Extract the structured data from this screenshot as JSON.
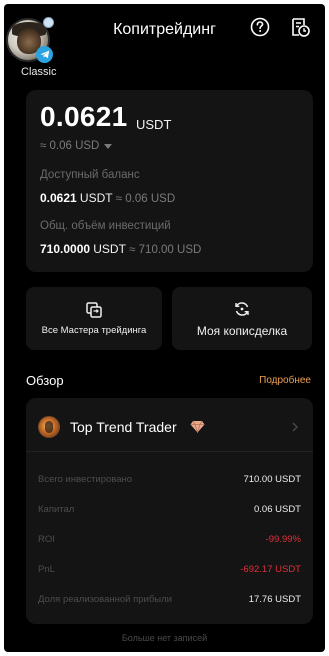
{
  "header": {
    "title": "Копитрейдинг",
    "account_label": "Classic",
    "icons": {
      "help": "help-circle-icon",
      "history": "document-clock-icon",
      "badge": "telegram-icon"
    }
  },
  "balance": {
    "amount": "0.0621",
    "unit": "USDT",
    "usd_approx": "≈ 0.06 USD",
    "available_label": "Доступный баланс",
    "available_amount": "0.0621",
    "available_unit": "USDT",
    "available_usd": "≈ 0.06 USD",
    "invested_label": "Общ. объём инвестиций",
    "invested_amount": "710.0000",
    "invested_unit": "USDT",
    "invested_usd": "≈ 710.00 USD"
  },
  "actions": {
    "all_masters": {
      "label": "Все Мастера трейдинга",
      "icon": "swap-square-icon"
    },
    "my_copy_deal": {
      "label": "Моя кописделка",
      "icon": "refresh-arrows-icon"
    }
  },
  "overview": {
    "title": "Обзор",
    "more_label": "Подробнее",
    "trader": {
      "name": "Top Trend Trader",
      "stats": [
        {
          "label": "Всего инвестировано",
          "value": "710.00 USDT",
          "negative": false
        },
        {
          "label": "Капитал",
          "value": "0.06 USDT",
          "negative": false
        },
        {
          "label": "ROI",
          "value": "-99.99%",
          "negative": true
        },
        {
          "label": "PnL",
          "value": "-692.17 USDT",
          "negative": true
        },
        {
          "label": "Доля реализованной прибыли",
          "value": "17.76 USDT",
          "negative": false
        }
      ]
    }
  },
  "footer": {
    "note": "Больше нет записей"
  },
  "colors": {
    "background": "#000000",
    "card": "#141414",
    "accent": "#f0a050",
    "negative": "#e0303a"
  }
}
